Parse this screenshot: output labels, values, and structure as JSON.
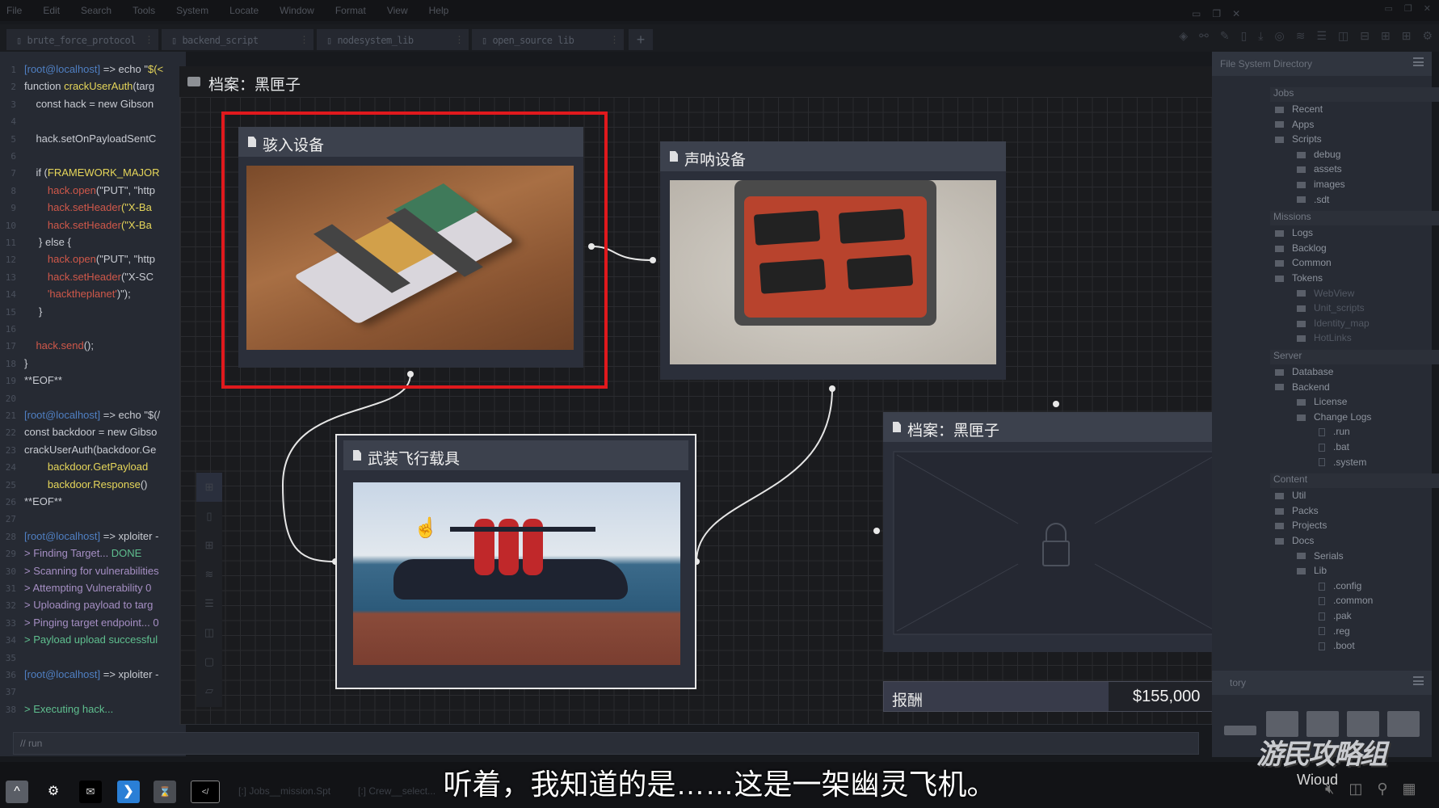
{
  "menu": [
    "File",
    "Edit",
    "Search",
    "Tools",
    "System",
    "Locate",
    "Window",
    "Format",
    "View",
    "Help"
  ],
  "tabs": [
    "brute_force_protocol",
    "backend_script",
    "nodesystem_lib",
    "open_source lib"
  ],
  "code": [
    [
      {
        "t": "[root@localhost]",
        "c": "#4f7fc2"
      },
      {
        "t": " => echo \"",
        "c": "#c9ccd3"
      },
      {
        "t": "$(<",
        "c": "#e6d65a"
      }
    ],
    [
      {
        "t": "function ",
        "c": "#c9ccd3"
      },
      {
        "t": "crackUserAuth",
        "c": "#e6d65a"
      },
      {
        "t": "(targ",
        "c": "#c9ccd3"
      }
    ],
    [
      {
        "t": "    const hack = new Gibson",
        "c": "#c9ccd3"
      }
    ],
    [],
    [
      {
        "t": "    hack.setOnPayloadSentC",
        "c": "#c9ccd3"
      }
    ],
    [],
    [
      {
        "t": "    if (",
        "c": "#c9ccd3"
      },
      {
        "t": "FRAMEWORK_MAJOR",
        "c": "#e6d65a"
      }
    ],
    [
      {
        "t": "        hack.open",
        "c": "#d0584a"
      },
      {
        "t": "(\"PUT\", \"http",
        "c": "#c9ccd3"
      }
    ],
    [
      {
        "t": "        hack.setHeader",
        "c": "#d0584a"
      },
      {
        "t": "(\"X-Ba",
        "c": "#e6d65a"
      }
    ],
    [
      {
        "t": "        hack.setHeader",
        "c": "#d0584a"
      },
      {
        "t": "(\"X-Ba",
        "c": "#e6d65a"
      }
    ],
    [
      {
        "t": "     } else {",
        "c": "#c9ccd3"
      }
    ],
    [
      {
        "t": "        hack.open",
        "c": "#d0584a"
      },
      {
        "t": "(\"PUT\", \"http",
        "c": "#c9ccd3"
      }
    ],
    [
      {
        "t": "        hack.setHeader",
        "c": "#d0584a"
      },
      {
        "t": "(\"X-SC",
        "c": "#c9ccd3"
      }
    ],
    [
      {
        "t": "        'hacktheplanet'",
        "c": "#d0584a"
      },
      {
        "t": ")\");",
        "c": "#c9ccd3"
      }
    ],
    [
      {
        "t": "     }",
        "c": "#c9ccd3"
      }
    ],
    [],
    [
      {
        "t": "    hack.send",
        "c": "#d0584a"
      },
      {
        "t": "();",
        "c": "#c9ccd3"
      }
    ],
    [
      {
        "t": "}",
        "c": "#c9ccd3"
      }
    ],
    [
      {
        "t": "**EOF**",
        "c": "#c9ccd3"
      }
    ],
    [],
    [
      {
        "t": "[root@localhost]",
        "c": "#4f7fc2"
      },
      {
        "t": " => echo \"$(/",
        "c": "#c9ccd3"
      }
    ],
    [
      {
        "t": "const backdoor = new Gibso",
        "c": "#c9ccd3"
      }
    ],
    [
      {
        "t": "crackUserAuth(backdoor.Ge",
        "c": "#c9ccd3"
      }
    ],
    [
      {
        "t": "        backdoor.GetPayload",
        "c": "#e6d65a"
      }
    ],
    [
      {
        "t": "        backdoor.Response",
        "c": "#e6d65a"
      },
      {
        "t": "()",
        "c": "#c9ccd3"
      }
    ],
    [
      {
        "t": "**EOF**",
        "c": "#c9ccd3"
      }
    ],
    [],
    [
      {
        "t": "[root@localhost]",
        "c": "#4f7fc2"
      },
      {
        "t": " => xploiter -",
        "c": "#c9ccd3"
      }
    ],
    [
      {
        "t": "> Finding Target... ",
        "c": "#a68fc4"
      },
      {
        "t": "DONE",
        "c": "#5fbf8f"
      }
    ],
    [
      {
        "t": "> Scanning for vulnerabilities",
        "c": "#a68fc4"
      }
    ],
    [
      {
        "t": "> Attempting Vulnerability 0",
        "c": "#a68fc4"
      }
    ],
    [
      {
        "t": "> Uploading payload to targ",
        "c": "#a68fc4"
      }
    ],
    [
      {
        "t": "> Pinging target endpoint... 0",
        "c": "#a68fc4"
      }
    ],
    [
      {
        "t": "> Payload upload successful",
        "c": "#5fbf8f"
      }
    ],
    [],
    [
      {
        "t": "[root@localhost]",
        "c": "#4f7fc2"
      },
      {
        "t": " => xploiter -",
        "c": "#c9ccd3"
      }
    ],
    [],
    [
      {
        "t": "> Executing hack...",
        "c": "#5fbf8f"
      }
    ]
  ],
  "run_input": "// run",
  "window": {
    "title": "档案：黑匣子"
  },
  "nodes": {
    "hack_device": "骇入设备",
    "sonar_device": "声呐设备",
    "armed_aircraft": "武装飞行载具",
    "black_box": "档案：黑匣子"
  },
  "reward": {
    "label": "报酬",
    "value": "$155,000"
  },
  "selection_color": "#e0191d",
  "file_panel": {
    "title": "File System Directory",
    "tree": [
      {
        "l": "Jobs",
        "k": "sec"
      },
      {
        "l": "Recent",
        "k": "f",
        "d": 1
      },
      {
        "l": "Apps",
        "k": "f",
        "d": 1
      },
      {
        "l": "Scripts",
        "k": "f",
        "d": 1
      },
      {
        "l": "debug",
        "k": "f",
        "d": 2
      },
      {
        "l": "assets",
        "k": "f",
        "d": 2
      },
      {
        "l": "images",
        "k": "f",
        "d": 2
      },
      {
        "l": ".sdt",
        "k": "f",
        "d": 2
      },
      {
        "l": "Missions",
        "k": "sec"
      },
      {
        "l": "Logs",
        "k": "f",
        "d": 1
      },
      {
        "l": "Backlog",
        "k": "f",
        "d": 1
      },
      {
        "l": "Common",
        "k": "f",
        "d": 1
      },
      {
        "l": "Tokens",
        "k": "f",
        "d": 1
      },
      {
        "l": "WebView",
        "k": "f",
        "d": 2,
        "dim": true
      },
      {
        "l": "Unit_scripts",
        "k": "f",
        "d": 2,
        "dim": true
      },
      {
        "l": "Identity_map",
        "k": "f",
        "d": 2,
        "dim": true
      },
      {
        "l": "HotLinks",
        "k": "f",
        "d": 2,
        "dim": true
      },
      {
        "l": "Server",
        "k": "sec"
      },
      {
        "l": "Database",
        "k": "f",
        "d": 1
      },
      {
        "l": "Backend",
        "k": "f",
        "d": 1
      },
      {
        "l": "License",
        "k": "f",
        "d": 2
      },
      {
        "l": "Change Logs",
        "k": "f",
        "d": 2
      },
      {
        "l": ".run",
        "k": "file",
        "d": 3
      },
      {
        "l": ".bat",
        "k": "file",
        "d": 3
      },
      {
        "l": ".system",
        "k": "file",
        "d": 3
      },
      {
        "l": "Content",
        "k": "sec"
      },
      {
        "l": "Util",
        "k": "f",
        "d": 1
      },
      {
        "l": "Packs",
        "k": "f",
        "d": 1
      },
      {
        "l": "Projects",
        "k": "f",
        "d": 1
      },
      {
        "l": "Docs",
        "k": "f",
        "d": 1
      },
      {
        "l": "Serials",
        "k": "f",
        "d": 2
      },
      {
        "l": "Lib",
        "k": "f",
        "d": 2
      },
      {
        "l": ".config",
        "k": "file",
        "d": 3
      },
      {
        "l": ".common",
        "k": "file",
        "d": 3
      },
      {
        "l": ".pak",
        "k": "file",
        "d": 3
      },
      {
        "l": ".reg",
        "k": "file",
        "d": 3
      },
      {
        "l": ".boot",
        "k": "file",
        "d": 3
      }
    ]
  },
  "second_panel": {
    "title": "tory"
  },
  "taskbar": {
    "items": [
      "Jobs__mission.Spt",
      "Crew__select..."
    ]
  },
  "subtitle": "听着，我知道的是……这是一架幽灵飞机。",
  "watermark": {
    "text": "游民攻略组",
    "sub": "Wioud"
  }
}
